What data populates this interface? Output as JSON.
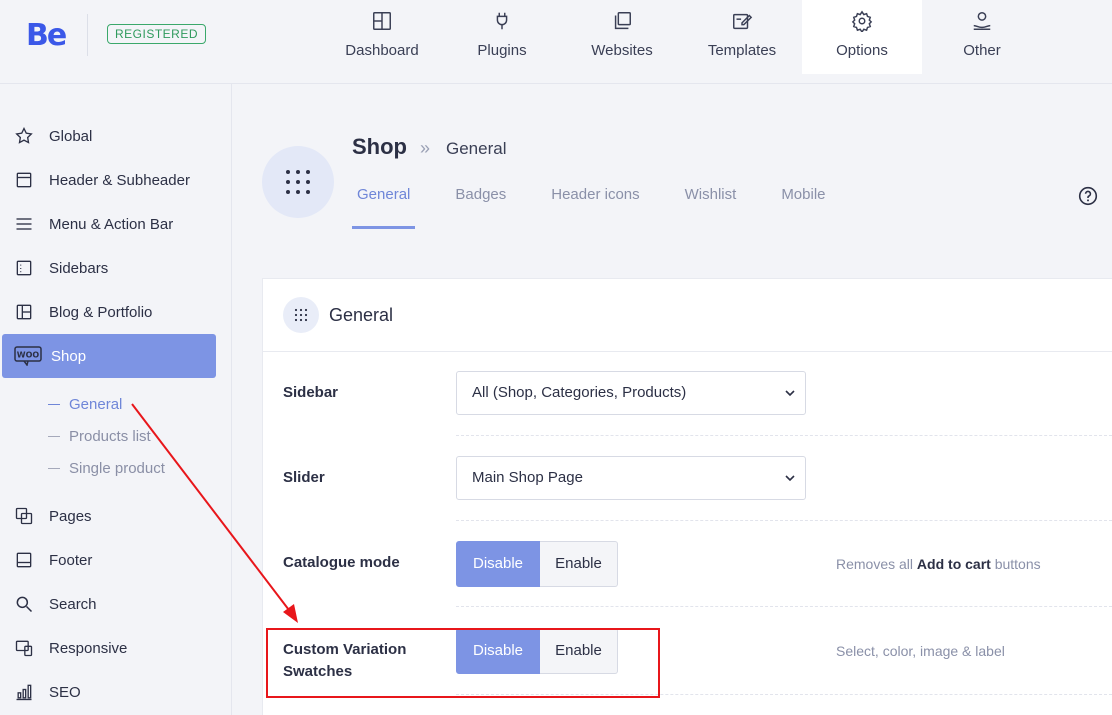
{
  "brand": {
    "logo": "Be",
    "badge": "REGISTERED"
  },
  "nav": [
    {
      "label": "Dashboard",
      "icon": "dashboard-icon"
    },
    {
      "label": "Plugins",
      "icon": "plug-icon"
    },
    {
      "label": "Websites",
      "icon": "websites-icon"
    },
    {
      "label": "Templates",
      "icon": "templates-icon"
    },
    {
      "label": "Options",
      "icon": "gear-icon",
      "active": true
    },
    {
      "label": "Other",
      "icon": "user-hand-icon"
    }
  ],
  "sidebar": {
    "items": [
      {
        "label": "Global",
        "icon": "star-icon"
      },
      {
        "label": "Header & Subheader",
        "icon": "header-icon"
      },
      {
        "label": "Menu & Action Bar",
        "icon": "menu-icon"
      },
      {
        "label": "Sidebars",
        "icon": "sidebars-icon"
      },
      {
        "label": "Blog & Portfolio",
        "icon": "blog-icon"
      },
      {
        "label": "Shop",
        "icon": "woo-icon",
        "active": true
      },
      {
        "label": "Pages",
        "icon": "pages-icon"
      },
      {
        "label": "Footer",
        "icon": "footer-icon"
      },
      {
        "label": "Search",
        "icon": "search-icon"
      },
      {
        "label": "Responsive",
        "icon": "responsive-icon"
      },
      {
        "label": "SEO",
        "icon": "seo-icon"
      }
    ],
    "shop_sub": [
      {
        "label": "General",
        "active": true
      },
      {
        "label": "Products list"
      },
      {
        "label": "Single product"
      }
    ]
  },
  "header": {
    "title": "Shop",
    "separator": "»",
    "subtitle": "General",
    "tabs": [
      "General",
      "Badges",
      "Header icons",
      "Wishlist",
      "Mobile"
    ],
    "active_tab": "General"
  },
  "panel": {
    "title": "General",
    "rows": {
      "sidebar": {
        "label": "Sidebar",
        "value": "All (Shop, Categories, Products)"
      },
      "slider": {
        "label": "Slider",
        "value": "Main Shop Page"
      },
      "catalogue": {
        "label": "Catalogue mode",
        "on": "Disable",
        "off": "Enable",
        "desc_pre": "Removes all ",
        "desc_bold": "Add to cart",
        "desc_post": " buttons"
      },
      "swatches": {
        "label_line1": "Custom Variation",
        "label_line2": "Swatches",
        "on": "Disable",
        "off": "Enable",
        "desc": "Select, color, image & label"
      }
    }
  },
  "colors": {
    "accent": "#7d94e4",
    "brand": "#3b58e8",
    "annotation": "#e8161b"
  }
}
